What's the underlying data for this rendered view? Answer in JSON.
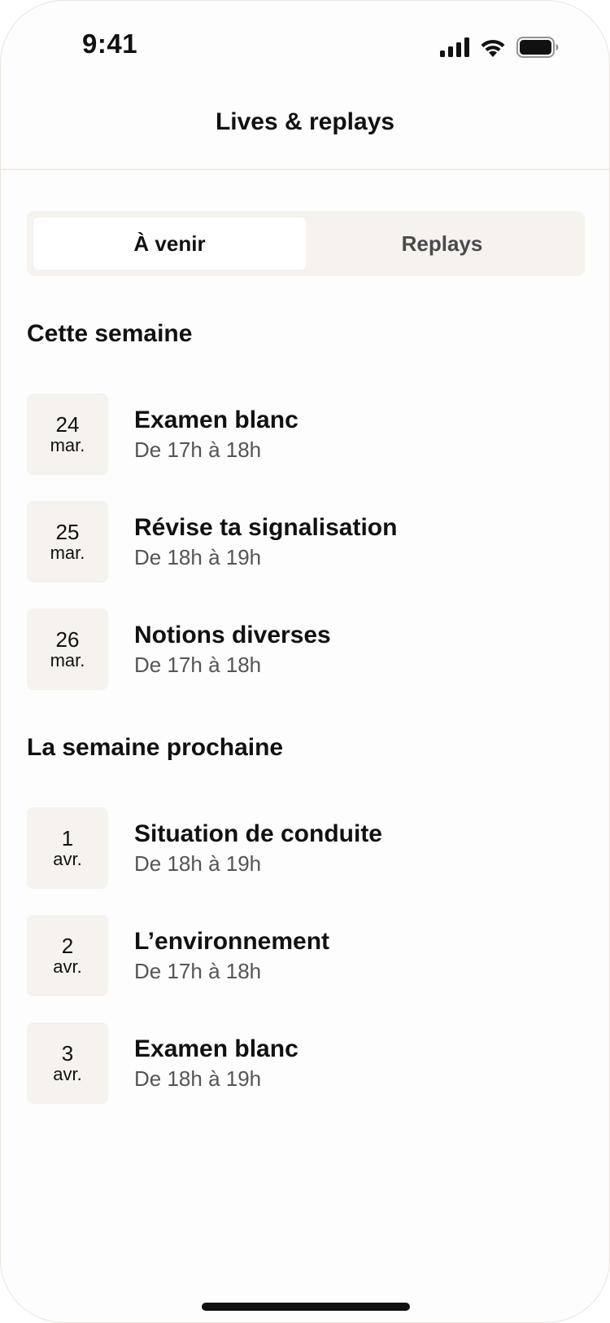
{
  "status_bar": {
    "time": "9:41",
    "icons": [
      "cellular-signal-icon",
      "wifi-icon",
      "battery-icon"
    ]
  },
  "header": {
    "title": "Lives & replays"
  },
  "tabs": [
    {
      "label": "À venir",
      "active": true
    },
    {
      "label": "Replays",
      "active": false
    }
  ],
  "sections": [
    {
      "title": "Cette semaine",
      "events": [
        {
          "day": "24",
          "month": "mar.",
          "title": "Examen blanc",
          "time": "De 17h à 18h"
        },
        {
          "day": "25",
          "month": "mar.",
          "title": "Révise ta signalisation",
          "time": "De 18h à 19h"
        },
        {
          "day": "26",
          "month": "mar.",
          "title": "Notions diverses",
          "time": "De 17h à 18h"
        }
      ]
    },
    {
      "title": "La semaine prochaine",
      "events": [
        {
          "day": "1",
          "month": "avr.",
          "title": "Situation de conduite",
          "time": "De 18h à 19h"
        },
        {
          "day": "2",
          "month": "avr.",
          "title": "L’environnement",
          "time": "De 17h à 18h"
        },
        {
          "day": "3",
          "month": "avr.",
          "title": "Examen blanc",
          "time": "De 18h à 19h"
        }
      ]
    }
  ],
  "colors": {
    "background": "#fdfdfd",
    "date_box": "#f6f2ee",
    "segmented_bg": "#f6f2ee",
    "text_primary": "#111111",
    "text_secondary": "#555555"
  }
}
